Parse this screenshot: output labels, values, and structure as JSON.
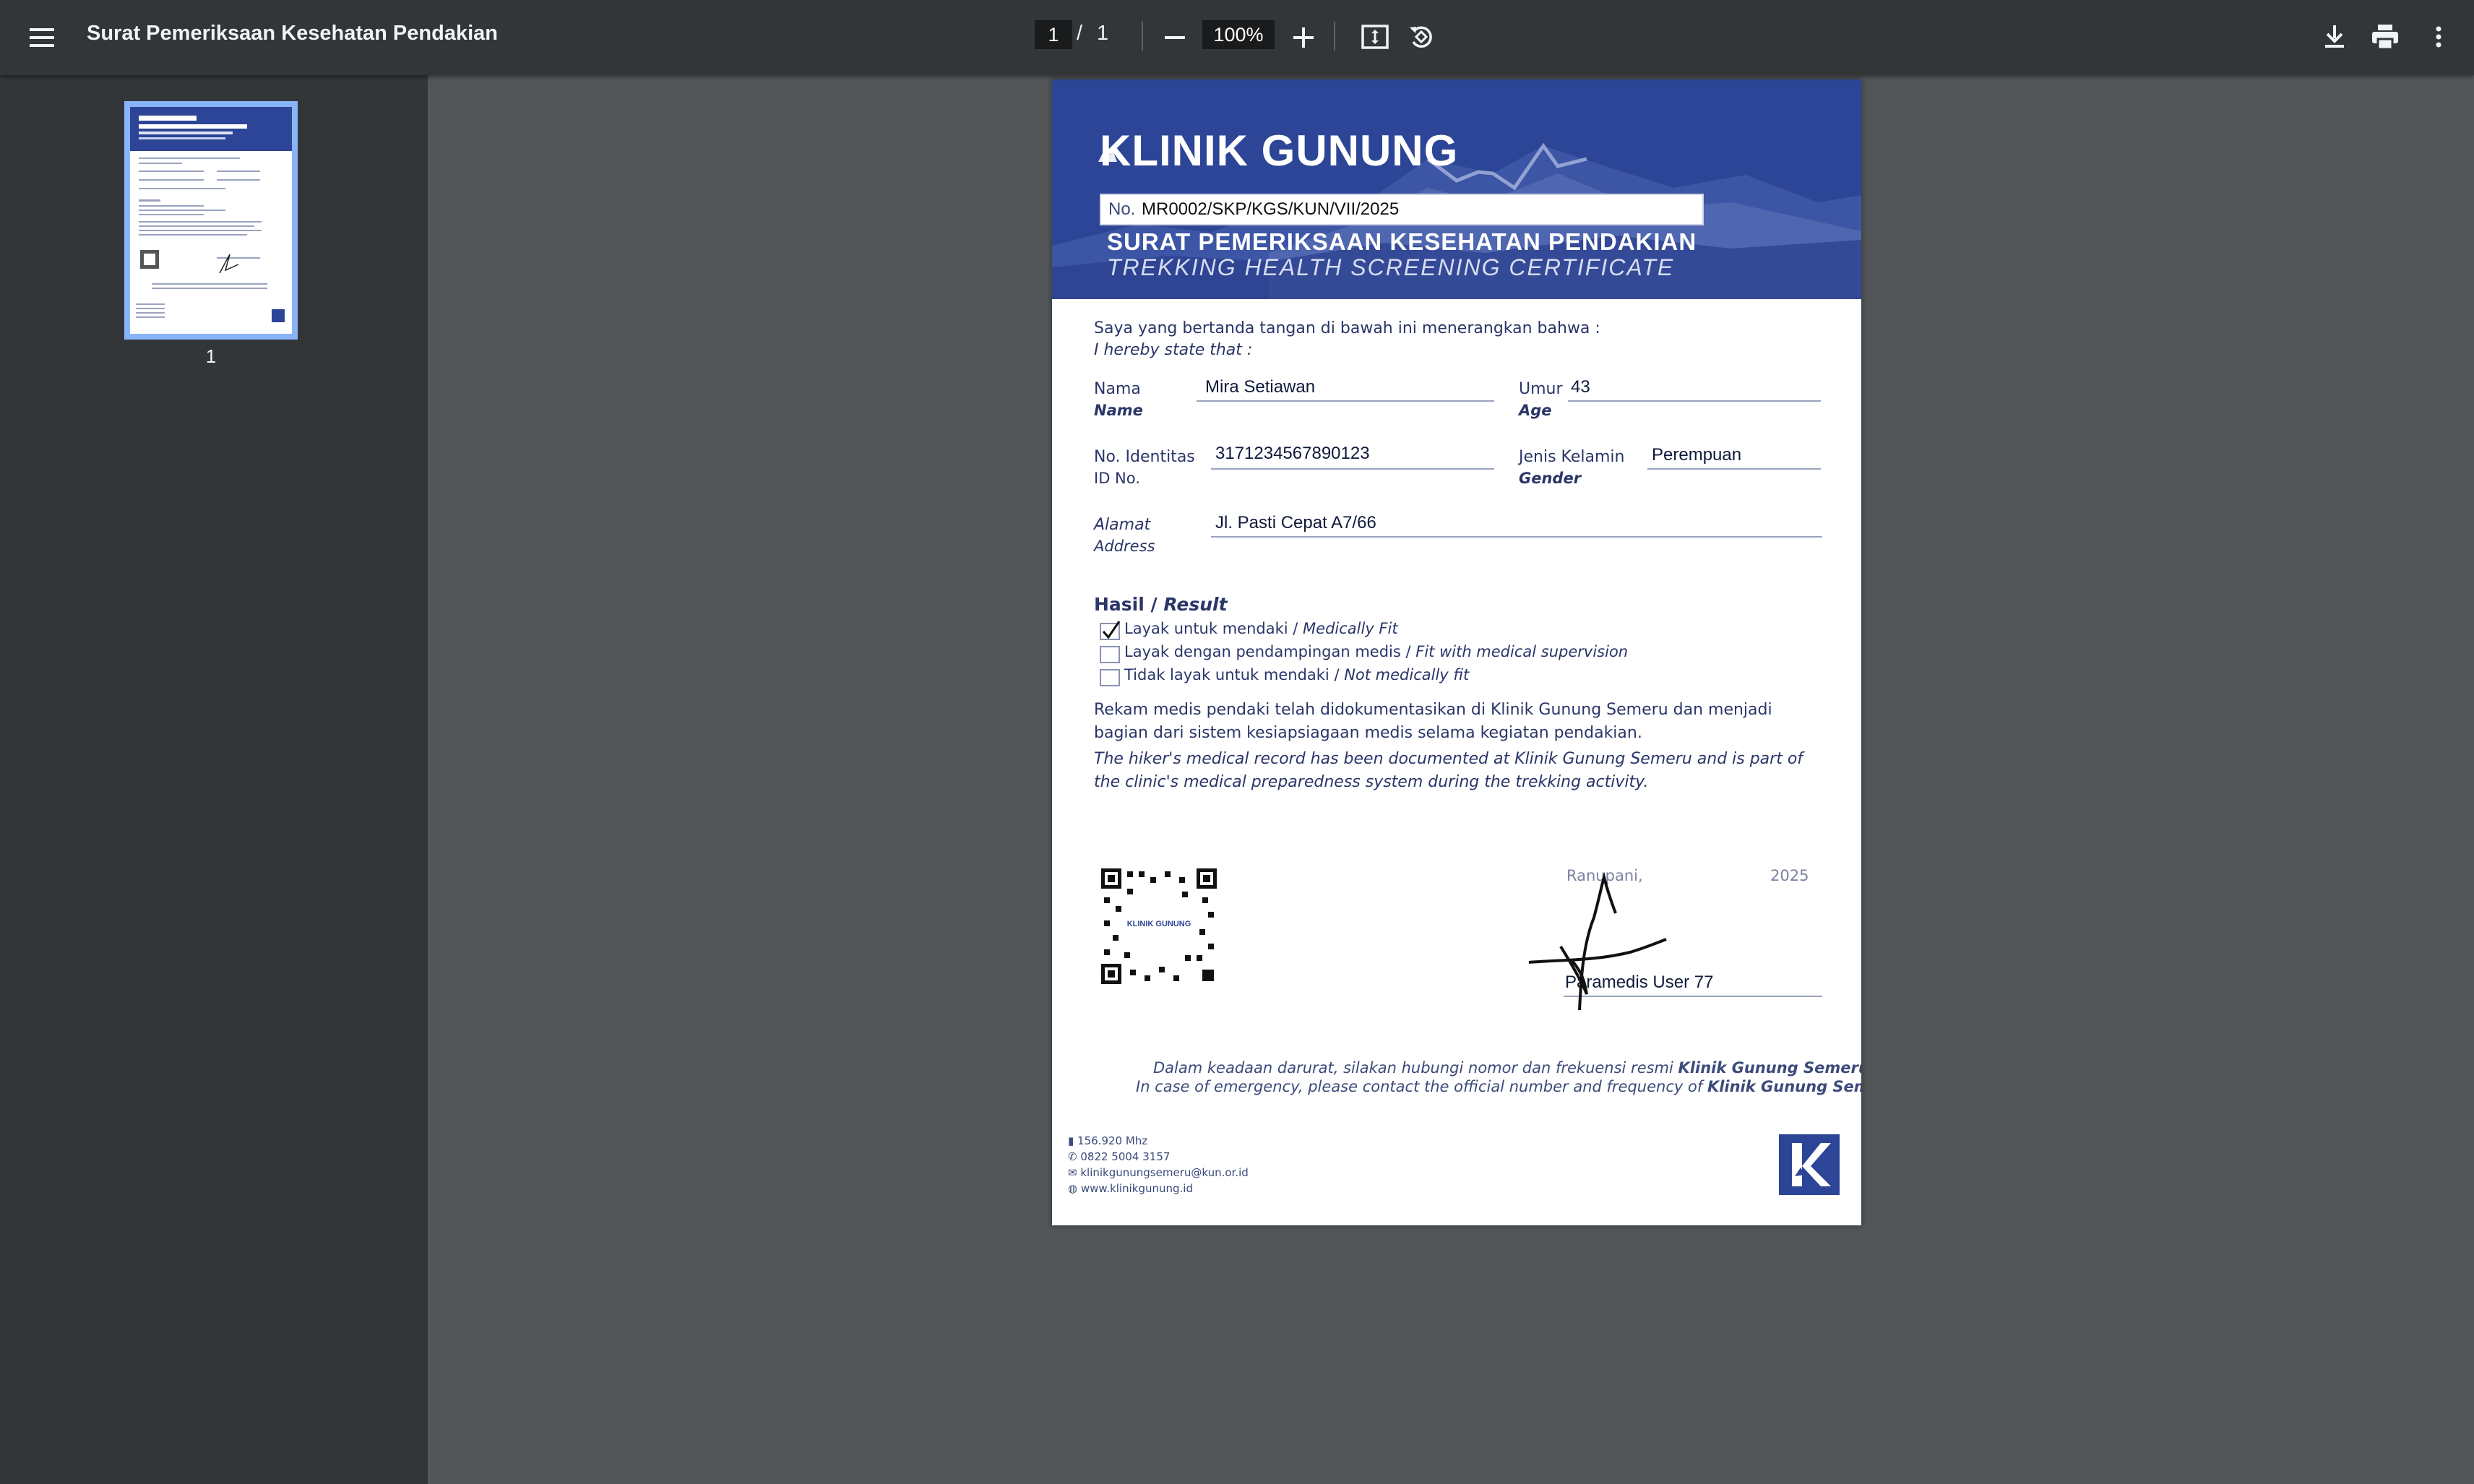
{
  "toolbar": {
    "title": "Surat Pemeriksaan Kesehatan Pendakian",
    "page_current": "1",
    "page_separator": "/",
    "page_total": "1",
    "zoom": "100%"
  },
  "sidebar": {
    "thumbnails": [
      {
        "label": "1"
      }
    ]
  },
  "document": {
    "logo_text": "KLINIK GUNUNG",
    "cert_no_label": "No.",
    "cert_no": "MR0002/SKP/KGS/KUN/VII/2025",
    "title_id": "SURAT PEMERIKSAAN KESEHATAN PENDAKIAN",
    "title_en": "TREKKING HEALTH SCREENING CERTIFICATE",
    "intro_id": "Saya yang bertanda tangan di bawah ini menerangkan bahwa :",
    "intro_en": "I hereby state that :",
    "fields": {
      "name_label_id": "Nama",
      "name_label_en": "Name",
      "name_value": "Mira Setiawan",
      "age_label_id": "Umur",
      "age_label_en": "Age",
      "age_value": "43",
      "id_label_id": "No. Identitas",
      "id_label_en": "ID No.",
      "id_value": "3171234567890123",
      "gender_label_id": "Jenis Kelamin",
      "gender_label_en": "Gender",
      "gender_value": "Perempuan",
      "address_label_id": "Alamat",
      "address_label_en": "Address",
      "address_value": "Jl. Pasti Cepat A7/66"
    },
    "result_heading_id": "Hasil /",
    "result_heading_en": "Result",
    "results": [
      {
        "label_id": "Layak untuk mendaki /",
        "label_en": "Medically Fit",
        "checked": true
      },
      {
        "label_id": "Layak dengan pendampingan medis /",
        "label_en": "Fit with medical supervision",
        "checked": false
      },
      {
        "label_id": "Tidak layak untuk mendaki /",
        "label_en": "Not medically fit",
        "checked": false
      }
    ],
    "note_id_1": "Rekam medis pendaki telah didokumentasikan di Klinik Gunung Semeru dan menjadi",
    "note_id_2": "bagian dari sistem kesiapsiagaan medis selama kegiatan pendakian.",
    "note_en_1": "The hiker's medical record has been documented at Klinik Gunung Semeru and is part of",
    "note_en_2": "the clinic's medical preparedness system during the trekking activity.",
    "qr_label": "KLINIK GUNUNG",
    "place": "Ranupani,",
    "year": "2025",
    "signer": "Paramedis User 77",
    "emergency_id_pre": "Dalam keadaan darurat, silakan hubungi nomor dan frekuensi resmi",
    "emergency_id_bold": "Klinik Gunung Semeru.",
    "emergency_en_pre": "In case of emergency, please contact the official number and frequency of",
    "emergency_en_bold": "Klinik Gunung Semeru.",
    "contacts": [
      {
        "icon": "radio-icon",
        "text": "156.920 Mhz"
      },
      {
        "icon": "phone-icon",
        "text": "0822 5004 3157"
      },
      {
        "icon": "mail-icon",
        "text": "klinikgunungsemeru@kun.or.id"
      },
      {
        "icon": "globe-icon",
        "text": "www.klinikgunung.id"
      }
    ]
  },
  "colors": {
    "toolbar_bg": "#323639",
    "viewer_bg": "#525659",
    "banner_blue": "#2d4596",
    "thumb_border": "#8ab4f8"
  }
}
